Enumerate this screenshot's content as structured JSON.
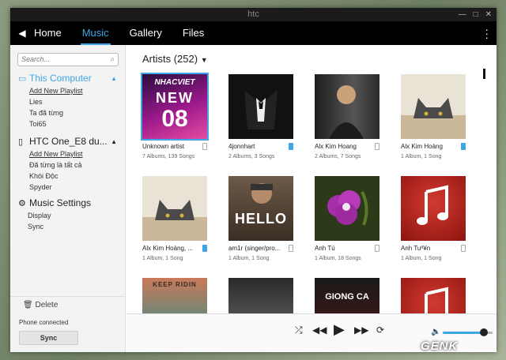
{
  "window": {
    "title": "htc"
  },
  "nav": {
    "tabs": [
      {
        "label": "Home"
      },
      {
        "label": "Music"
      },
      {
        "label": "Gallery"
      },
      {
        "label": "Files"
      }
    ]
  },
  "sidebar": {
    "search_placeholder": "Search...",
    "computer": {
      "title": "This Computer",
      "add": "Add New Playlist",
      "items": [
        "Lies",
        "Ta đã từng",
        "Toi65"
      ]
    },
    "phone": {
      "title": "HTC One_E8 du...",
      "add": "Add New Playlist",
      "items": [
        "Đã từng là tất cả",
        "Khói Độc",
        "Spyder"
      ]
    },
    "settings": {
      "title": "Music Settings",
      "items": [
        "Display",
        "Sync"
      ]
    },
    "delete_label": "Delete",
    "status": "Phone connected",
    "sync_label": "Sync"
  },
  "main": {
    "header": "Artists (252)",
    "cards": [
      {
        "name": "Unknown artist",
        "meta": "7 Albums, 139 Songs",
        "synced": false
      },
      {
        "name": "4jonnhart",
        "meta": "2 Albums, 3 Songs",
        "synced": true
      },
      {
        "name": "Alx Kim Hoang",
        "meta": "2 Albums, 7 Songs",
        "synced": false
      },
      {
        "name": "Alx Kim Hoàng",
        "meta": "1 Album, 1 Song",
        "synced": true
      },
      {
        "name": "Alx Kim Hoàng, ...",
        "meta": "1 Album, 1 Song",
        "synced": true
      },
      {
        "name": "am1r (singer/pro...",
        "meta": "1 Album, 1 Song",
        "synced": false
      },
      {
        "name": "Anh Tú",
        "meta": "1 Album, 18 Songs",
        "synced": false
      },
      {
        "name": "Anh Tuº¥n",
        "meta": "1 Album, 1 Song",
        "synced": false
      },
      {
        "name": "",
        "meta": "",
        "synced": false
      },
      {
        "name": "",
        "meta": "",
        "synced": false
      },
      {
        "name": "",
        "meta": "",
        "synced": false
      },
      {
        "name": "",
        "meta": "",
        "synced": false
      }
    ],
    "thumb_text": {
      "card0_top": "NHACVIET",
      "card0_mid": "NEW",
      "card0_num": "08",
      "card5": "HELLO",
      "card8": "KEEP RIDIN",
      "card10": "GIONG CA"
    }
  },
  "player": {
    "volume": 0.82
  },
  "watermark": "GENK"
}
